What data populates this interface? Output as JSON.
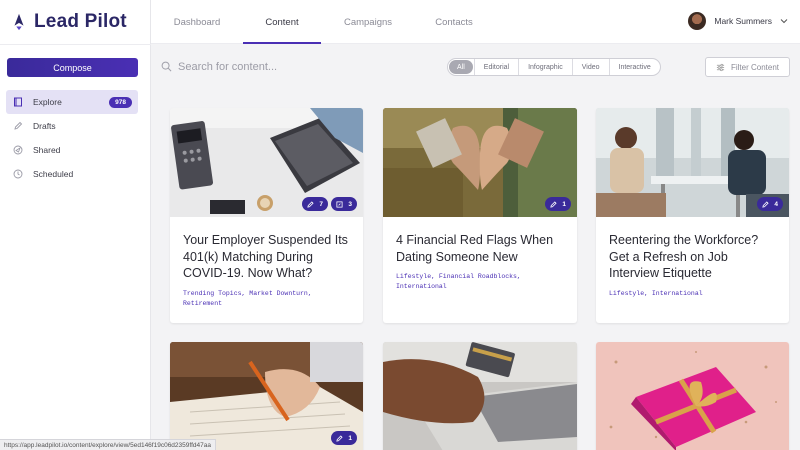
{
  "brand": {
    "name": "Lead Pilot",
    "accent": "#4a2fb4",
    "logo_color": "#2b2766"
  },
  "sidebar": {
    "compose_label": "Compose",
    "items": [
      {
        "label": "Explore",
        "icon": "book-icon",
        "badge": "978",
        "active": true
      },
      {
        "label": "Drafts",
        "icon": "pencil-icon"
      },
      {
        "label": "Shared",
        "icon": "send-icon"
      },
      {
        "label": "Scheduled",
        "icon": "clock-icon"
      }
    ]
  },
  "topnav": {
    "tabs": [
      "Dashboard",
      "Content",
      "Campaigns",
      "Contacts"
    ],
    "active_tab": "Content",
    "user_name": "Mark Summers"
  },
  "search": {
    "placeholder": "Search for content..."
  },
  "filters": {
    "options": [
      "All",
      "Editorial",
      "Infographic",
      "Video",
      "Interactive"
    ],
    "selected": "All",
    "filter_button": "Filter Content"
  },
  "cards": [
    {
      "title": "Your Employer Suspended Its 401(k) Matching During COVID-19. Now What?",
      "tags": "Trending Topics, Market Downturn, Retirement",
      "badges": [
        {
          "icon": "pencil-icon",
          "count": "7"
        },
        {
          "icon": "share-icon",
          "count": "3"
        }
      ],
      "image": "laptop-desk"
    },
    {
      "title": "4 Financial Red Flags When Dating Someone New",
      "tags": "Lifestyle, Financial Roadblocks, International",
      "badges": [
        {
          "icon": "pencil-icon",
          "count": "1"
        }
      ],
      "image": "heart-hands"
    },
    {
      "title": "Reentering the Workforce? Get a Refresh on Job Interview Etiquette",
      "tags": "Lifestyle, International",
      "badges": [
        {
          "icon": "pencil-icon",
          "count": "4"
        }
      ],
      "image": "interview"
    },
    {
      "title": "",
      "tags": "",
      "badges": [
        {
          "icon": "pencil-icon",
          "count": "1"
        }
      ],
      "image": "writing"
    },
    {
      "title": "",
      "tags": "",
      "badges": [],
      "image": "card-laptop"
    },
    {
      "title": "",
      "tags": "",
      "badges": [],
      "image": "gift"
    }
  ],
  "status_url": "https://app.leadpilot.io/content/explore/view/5ed146f19c06d2359ffd47aa"
}
